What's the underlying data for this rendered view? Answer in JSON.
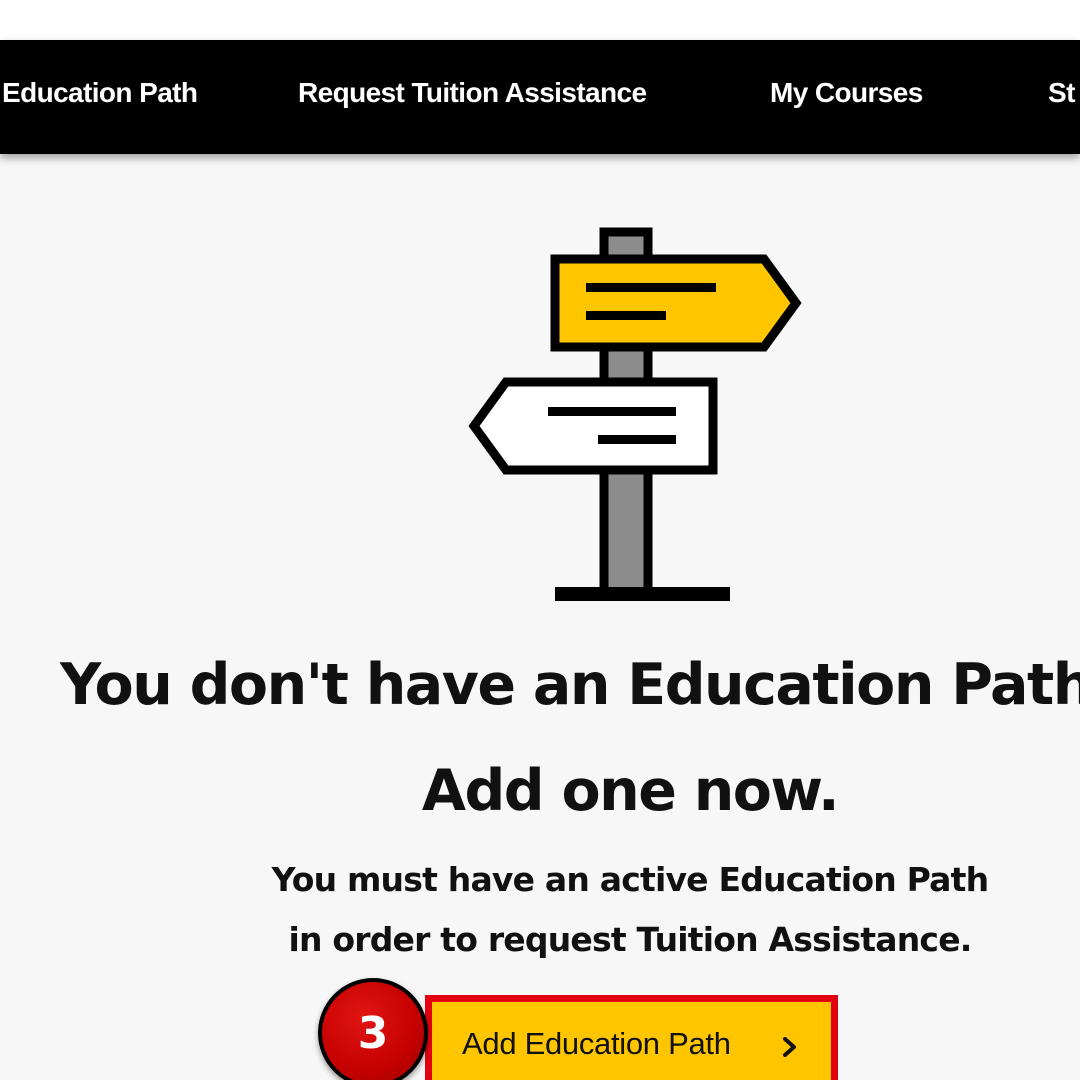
{
  "nav": {
    "items": [
      {
        "label": "Education Path"
      },
      {
        "label": "Request Tuition Assistance"
      },
      {
        "label": "My Courses"
      },
      {
        "label": "St"
      }
    ]
  },
  "empty_state": {
    "illustration_icon": "signpost-icon",
    "headline": "You don't have an Education Path",
    "subheadline": "Add one now.",
    "message_line_1": "You must have an active Education Path",
    "message_line_2": "in order to request Tuition Assistance.",
    "button_label": "Add Education Path",
    "button_icon": "chevron-right-icon"
  },
  "annotation": {
    "step_number": "3"
  },
  "colors": {
    "nav_background": "#000000",
    "accent_yellow": "#ffc600",
    "highlight_red": "#e3000f",
    "badge_red": "#c40000",
    "page_background": "#f7f7f7"
  }
}
